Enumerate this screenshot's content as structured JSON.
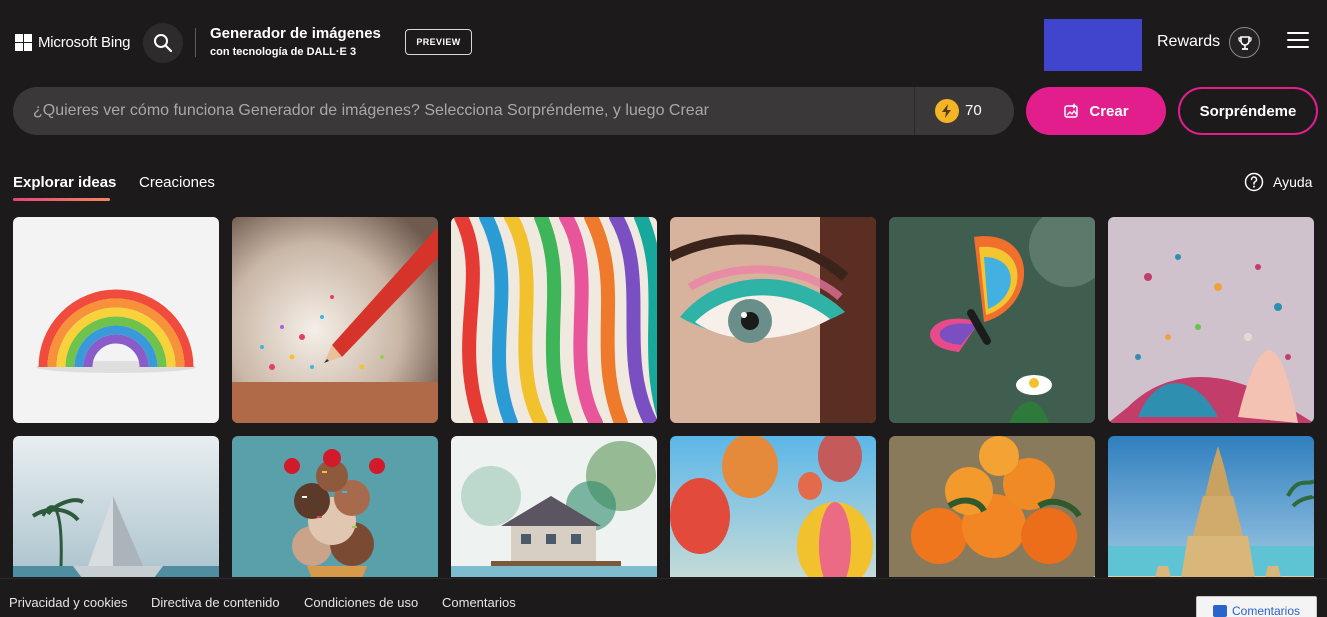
{
  "header": {
    "logo_text": "Microsoft Bing",
    "title": "Generador de imágenes",
    "subtitle": "con tecnología de DALL·E 3",
    "badge": "PREVIEW",
    "rewards_label": "Rewards",
    "avatar_color": "#3f45cc"
  },
  "prompt": {
    "placeholder": "¿Quieres ver cómo funciona Generador de imágenes? Selecciona Sorpréndeme, y luego Crear",
    "value": "",
    "boosts": "70"
  },
  "buttons": {
    "create": "Crear",
    "surprise": "Sorpréndeme"
  },
  "tabs": {
    "explore": "Explorar ideas",
    "creations": "Creaciones",
    "help": "Ayuda"
  },
  "grid": {
    "tiles": [
      {
        "subject": "paper-rainbow",
        "bg": "#f2f2f2"
      },
      {
        "subject": "pencil-glitter",
        "bg": "#c9b8a8"
      },
      {
        "subject": "colorful-ribbons",
        "bg": "#e85a3c"
      },
      {
        "subject": "eye-makeup",
        "bg": "#d9b7a4"
      },
      {
        "subject": "rainbow-butterfly",
        "bg": "#3c5a4c"
      },
      {
        "subject": "paint-splash",
        "bg": "#cdbfc9"
      },
      {
        "subject": "paper-sailboat",
        "bg": "#9fb6c2"
      },
      {
        "subject": "ice-cream-cone",
        "bg": "#5fa3ad"
      },
      {
        "subject": "lake-house",
        "bg": "#e9efee"
      },
      {
        "subject": "hot-air-balloons",
        "bg": "#7cc3e6"
      },
      {
        "subject": "oranges-bowl",
        "bg": "#8a7a5c"
      },
      {
        "subject": "sand-castle",
        "bg": "#8cbddc"
      }
    ]
  },
  "footer": {
    "links": [
      "Privacidad y cookies",
      "Directiva de contenido",
      "Condiciones de uso",
      "Comentarios"
    ],
    "feedback_button": "Comentarios"
  },
  "colors": {
    "background": "#1c1a1a",
    "accent": "#e21e8c",
    "prompt_bg": "#3a3838",
    "boost": "#f3b526",
    "feedback_text": "#2a63c9"
  }
}
